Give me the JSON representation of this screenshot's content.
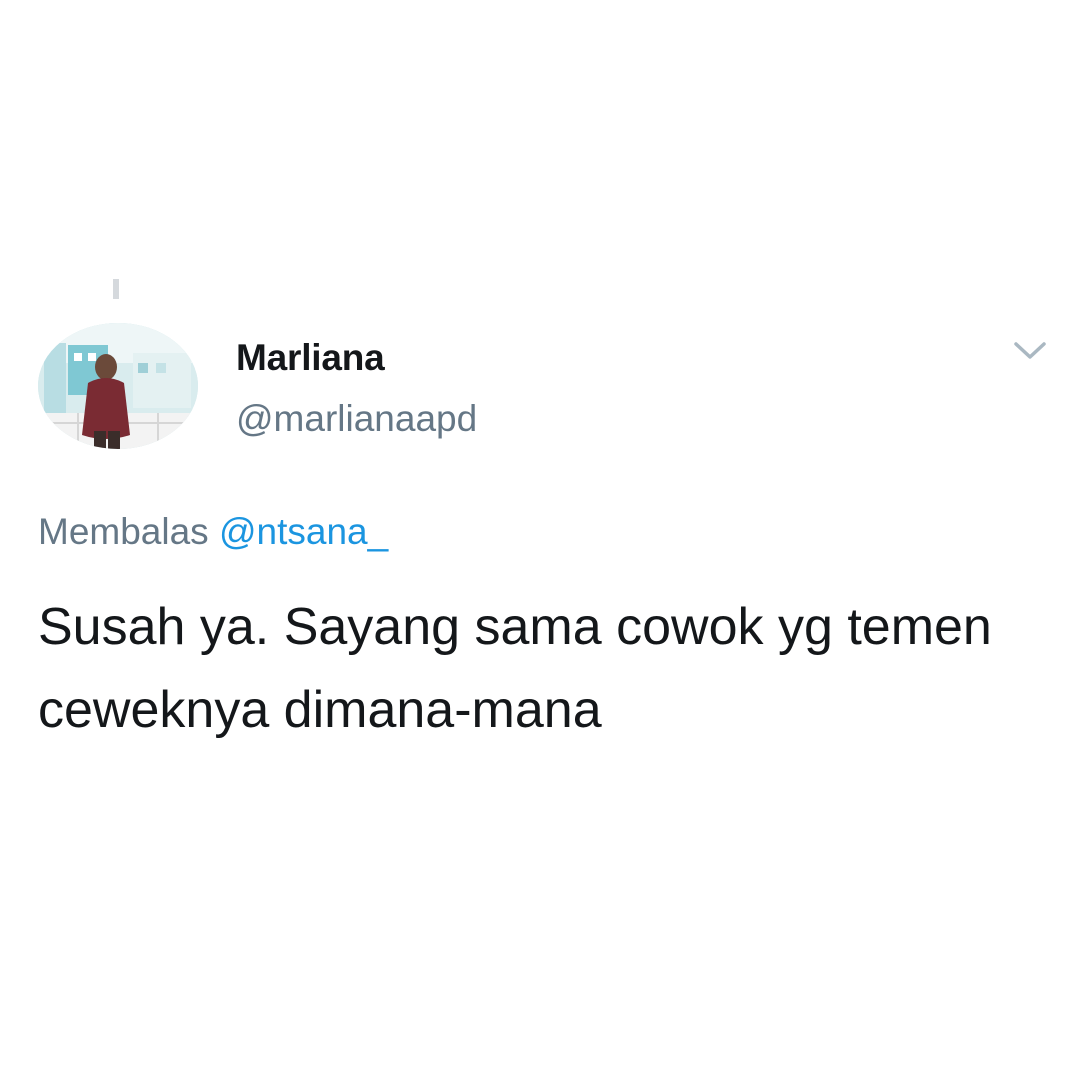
{
  "tweet": {
    "author": {
      "display_name": "Marliana",
      "handle": "@marlianaapd"
    },
    "reply_prefix": "Membalas",
    "reply_to": "@ntsana_",
    "text": "Susah ya. Sayang sama cowok yg temen ceweknya dimana-mana",
    "menu_icon": "chevron-down-icon",
    "colors": {
      "text": "#14171a",
      "secondary": "#657786",
      "mention": "#1b95e0"
    }
  }
}
